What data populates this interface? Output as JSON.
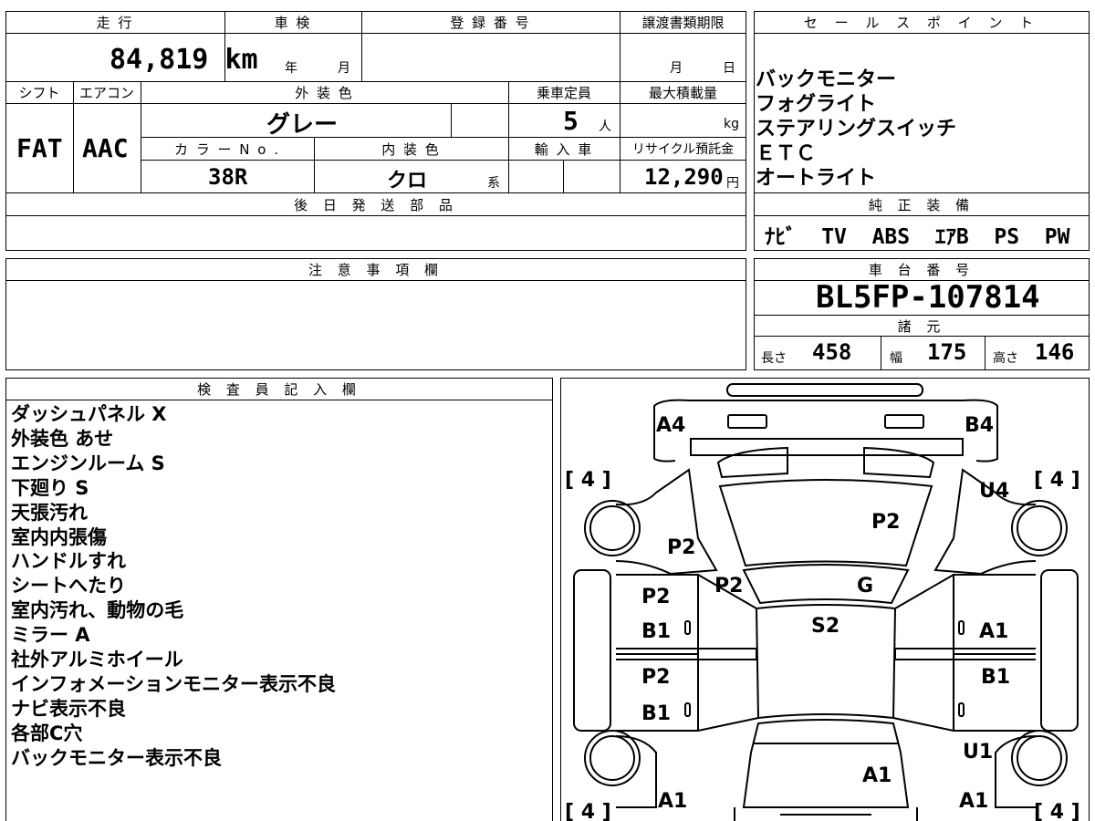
{
  "mileage": {
    "label": "走 行",
    "value": "84,819",
    "unit": "km"
  },
  "inspection": {
    "label": "車 検",
    "year_unit": "年",
    "month_unit": "月"
  },
  "registration": {
    "label": "登 録 番 号"
  },
  "transfer_deadline": {
    "label": "譲渡書類期限",
    "month_unit": "月",
    "day_unit": "日"
  },
  "shift": {
    "label": "シフト",
    "value": "FAT"
  },
  "aircon": {
    "label": "エアコン",
    "value": "AAC"
  },
  "exterior_color": {
    "label": "外 装 色",
    "value": "グレー"
  },
  "capacity": {
    "label": "乗車定員",
    "value": "5",
    "unit": "人"
  },
  "max_load": {
    "label": "最大積載量",
    "unit": "kg"
  },
  "color_no": {
    "label": "カ ラ ー N o .",
    "value": "38R"
  },
  "interior_color": {
    "label": "内 装 色",
    "value": "クロ",
    "unit": "系"
  },
  "import": {
    "label": "輸 入 車"
  },
  "recycle_fee": {
    "label": "リサイクル預託金",
    "value": "12,290",
    "unit": "円"
  },
  "later_parts": {
    "label": "後 日 発 送 部 品"
  },
  "sales_points": {
    "label": "セ ー ル ス ポ イ ン ト",
    "items": [
      "バックモニター",
      "フォグライト",
      "ステアリングスイッチ",
      "ＥＴＣ",
      "オートライト"
    ]
  },
  "genuine_equipment": {
    "label": "純 正 装 備",
    "value": "ﾅﾋﾞ  TV  ABS  ｴｱB  PS  PW"
  },
  "notes": {
    "label": "注 意 事 項 欄"
  },
  "chassis_number": {
    "label": "車 台 番 号",
    "value": "BL5FP-107814"
  },
  "specs": {
    "label": "諸 元",
    "length_label": "長さ",
    "length": "458",
    "width_label": "幅",
    "width": "175",
    "height_label": "高さ",
    "height": "146"
  },
  "inspector": {
    "label": "検 査 員 記 入 欄",
    "remarks": [
      "ダッシュパネル X",
      "外装色 あせ",
      "エンジンルーム S",
      "下廻り S",
      "天張汚れ",
      "室内内張傷",
      "ハンドルすれ",
      "シートへたり",
      "室内汚れ、動物の毛",
      "ミラー A",
      "社外アルミホイール",
      "インフォメーションモニター表示不良",
      "ナビ表示不良",
      "各部C穴",
      "バックモニター表示不良"
    ]
  },
  "diagram": {
    "tire_fl": "[ 4 ]",
    "tire_fr": "[ 4 ]",
    "tire_rl": "[ 4 ]",
    "tire_rr": "[ 4 ]",
    "front_left": "A4",
    "front_right": "B4",
    "right_fender": "U4",
    "hood": "P2",
    "left_fender": "P2",
    "left_pillar": "P2",
    "windshield": "G",
    "roof": "S2",
    "front_door_left_1": "P2",
    "front_door_left_2": "B1",
    "front_door_right": "A1",
    "rear_door_left_1": "P2",
    "rear_door_left_2": "B1",
    "rear_door_right": "B1",
    "rear_right_fender": "U1",
    "trunk": "A1",
    "rear_left": "A1",
    "rear_right": "A1",
    "small_zero": "0"
  }
}
